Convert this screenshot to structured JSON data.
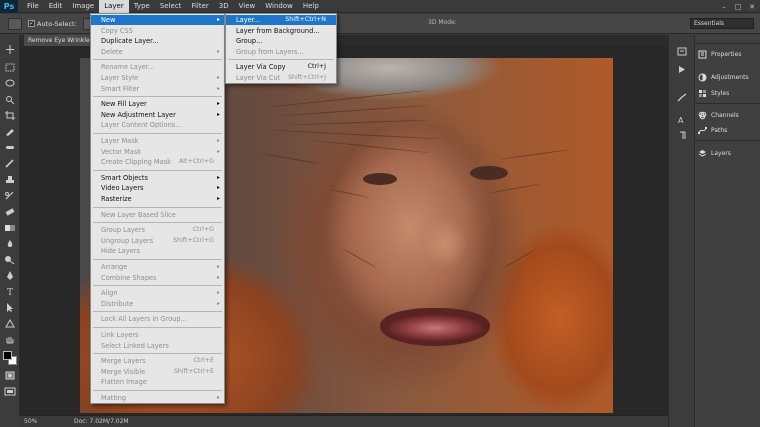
{
  "app": {
    "logo": "Ps"
  },
  "menubar": {
    "items": [
      "File",
      "Edit",
      "Image",
      "Layer",
      "Type",
      "Select",
      "Filter",
      "3D",
      "View",
      "Window",
      "Help"
    ],
    "active": "Layer"
  },
  "window_controls": {
    "minimize": "–",
    "maximize": "□",
    "close": "✕"
  },
  "options_bar": {
    "auto_select_label": "Auto-Select:",
    "auto_select_checked": "✓",
    "mode_3d_label": "3D Mode:",
    "workspace": "Essentials"
  },
  "document": {
    "tab_title": "Remove Eye Wrinkles"
  },
  "status": {
    "zoom": "50%",
    "doc_size": "Doc: 7.02M/7.02M"
  },
  "layer_menu": {
    "items": [
      {
        "label": "New",
        "shortcut": "",
        "submenu": true,
        "disabled": false,
        "highlight": true
      },
      {
        "label": "Copy CSS",
        "shortcut": "",
        "submenu": false,
        "disabled": true
      },
      {
        "label": "Duplicate Layer...",
        "shortcut": "",
        "submenu": false,
        "disabled": false
      },
      {
        "label": "Delete",
        "shortcut": "",
        "submenu": true,
        "disabled": true
      },
      {
        "sep": true
      },
      {
        "label": "Rename Layer...",
        "shortcut": "",
        "submenu": false,
        "disabled": true
      },
      {
        "label": "Layer Style",
        "shortcut": "",
        "submenu": true,
        "disabled": true
      },
      {
        "label": "Smart Filter",
        "shortcut": "",
        "submenu": true,
        "disabled": true
      },
      {
        "sep": true
      },
      {
        "label": "New Fill Layer",
        "shortcut": "",
        "submenu": true,
        "disabled": false
      },
      {
        "label": "New Adjustment Layer",
        "shortcut": "",
        "submenu": true,
        "disabled": false
      },
      {
        "label": "Layer Content Options...",
        "shortcut": "",
        "submenu": false,
        "disabled": true
      },
      {
        "sep": true
      },
      {
        "label": "Layer Mask",
        "shortcut": "",
        "submenu": true,
        "disabled": true
      },
      {
        "label": "Vector Mask",
        "shortcut": "",
        "submenu": true,
        "disabled": true
      },
      {
        "label": "Create Clipping Mask",
        "shortcut": "Alt+Ctrl+G",
        "submenu": false,
        "disabled": true
      },
      {
        "sep": true
      },
      {
        "label": "Smart Objects",
        "shortcut": "",
        "submenu": true,
        "disabled": false
      },
      {
        "label": "Video Layers",
        "shortcut": "",
        "submenu": true,
        "disabled": false
      },
      {
        "label": "Rasterize",
        "shortcut": "",
        "submenu": true,
        "disabled": false
      },
      {
        "sep": true
      },
      {
        "label": "New Layer Based Slice",
        "shortcut": "",
        "submenu": false,
        "disabled": true
      },
      {
        "sep": true
      },
      {
        "label": "Group Layers",
        "shortcut": "Ctrl+G",
        "submenu": false,
        "disabled": true
      },
      {
        "label": "Ungroup Layers",
        "shortcut": "Shift+Ctrl+G",
        "submenu": false,
        "disabled": true
      },
      {
        "label": "Hide Layers",
        "shortcut": "",
        "submenu": false,
        "disabled": true
      },
      {
        "sep": true
      },
      {
        "label": "Arrange",
        "shortcut": "",
        "submenu": true,
        "disabled": true
      },
      {
        "label": "Combine Shapes",
        "shortcut": "",
        "submenu": true,
        "disabled": true
      },
      {
        "sep": true
      },
      {
        "label": "Align",
        "shortcut": "",
        "submenu": true,
        "disabled": true
      },
      {
        "label": "Distribute",
        "shortcut": "",
        "submenu": true,
        "disabled": true
      },
      {
        "sep": true
      },
      {
        "label": "Lock All Layers in Group...",
        "shortcut": "",
        "submenu": false,
        "disabled": true
      },
      {
        "sep": true
      },
      {
        "label": "Link Layers",
        "shortcut": "",
        "submenu": false,
        "disabled": true
      },
      {
        "label": "Select Linked Layers",
        "shortcut": "",
        "submenu": false,
        "disabled": true
      },
      {
        "sep": true
      },
      {
        "label": "Merge Layers",
        "shortcut": "Ctrl+E",
        "submenu": false,
        "disabled": true
      },
      {
        "label": "Merge Visible",
        "shortcut": "Shift+Ctrl+E",
        "submenu": false,
        "disabled": true
      },
      {
        "label": "Flatten Image",
        "shortcut": "",
        "submenu": false,
        "disabled": true
      },
      {
        "sep": true
      },
      {
        "label": "Matting",
        "shortcut": "",
        "submenu": true,
        "disabled": true
      }
    ]
  },
  "new_submenu": {
    "items": [
      {
        "label": "Layer...",
        "shortcut": "Shift+Ctrl+N",
        "disabled": false,
        "highlight": true
      },
      {
        "label": "Layer from Background...",
        "shortcut": "",
        "disabled": false
      },
      {
        "label": "Group...",
        "shortcut": "",
        "disabled": false
      },
      {
        "label": "Group from Layers...",
        "shortcut": "",
        "disabled": true
      },
      {
        "sep": true
      },
      {
        "label": "Layer Via Copy",
        "shortcut": "Ctrl+J",
        "disabled": false
      },
      {
        "label": "Layer Via Cut",
        "shortcut": "Shift+Ctrl+J",
        "disabled": true
      }
    ]
  },
  "panels": {
    "group1": [
      "Properties",
      "Adjustments",
      "Styles"
    ],
    "group2": [
      "Channels",
      "Paths"
    ],
    "group3": [
      "Layers"
    ]
  },
  "colors": {
    "highlight": "#1f76c9",
    "menu_bg": "#e6e6e6",
    "disabled_text": "#8e8e8e",
    "ps_logo": "#4fb3f0"
  }
}
